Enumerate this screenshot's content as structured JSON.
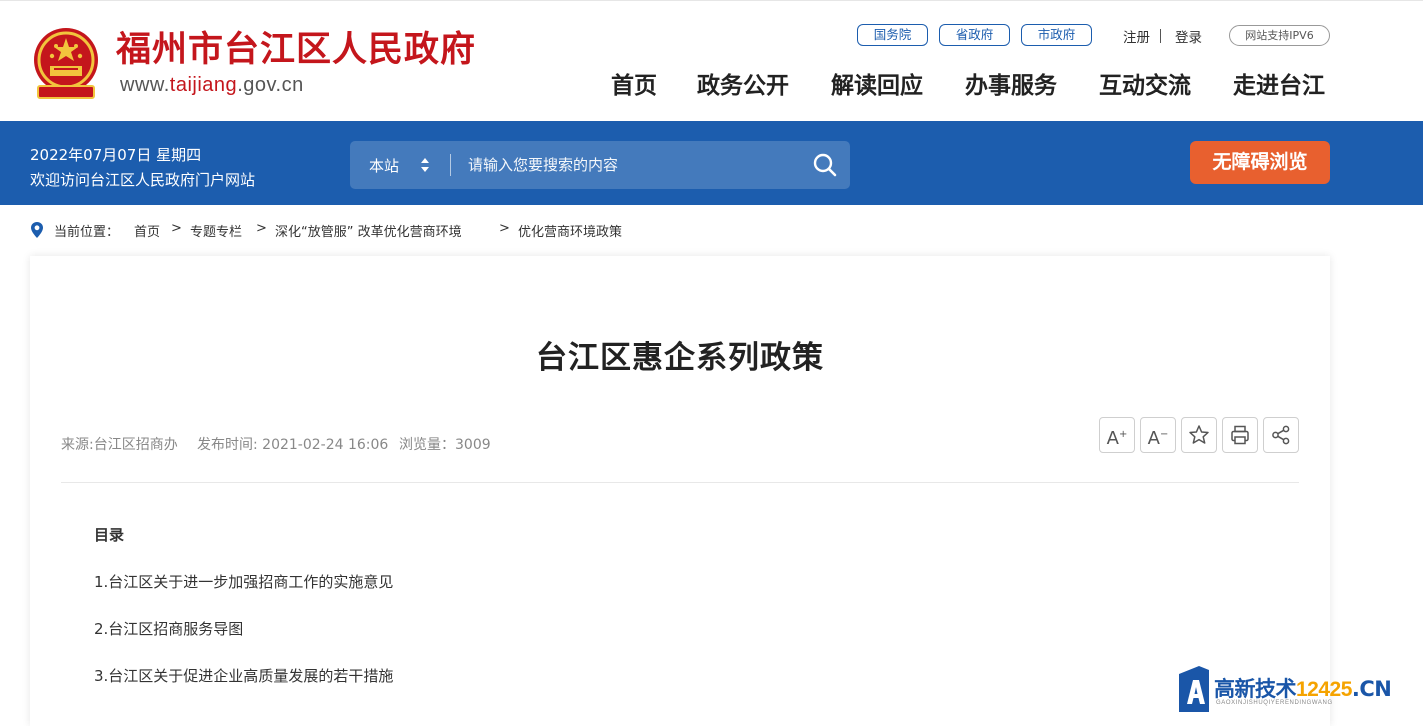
{
  "header": {
    "site_name": "福州市台江区人民政府",
    "domain_prefix": "www.",
    "domain_highlight": "taijiang",
    "domain_suffix": ".gov.cn",
    "gov_links": [
      "国务院",
      "省政府",
      "市政府"
    ],
    "register_label": "注册",
    "login_label": "登录",
    "ipv6_label": "网站支持IPV6",
    "nav": [
      "首页",
      "政务公开",
      "解读回应",
      "办事服务",
      "互动交流",
      "走进台江"
    ]
  },
  "band": {
    "date_text": "2022年07月07日 星期四",
    "welcome_text": "欢迎访问台江区人民政府门户网站",
    "search_scope": "本站",
    "search_placeholder": "请输入您要搜索的内容",
    "accessibility_label": "无障碍浏览"
  },
  "breadcrumb": {
    "label": "当前位置：",
    "items": [
      "首页",
      "专题专栏",
      "深化“放管服” 改革优化营商环境",
      "优化营商环境政策"
    ],
    "separator": ">"
  },
  "article": {
    "title": "台江区惠企系列政策",
    "source": "来源:台江区招商办",
    "publish_time": "发布时间: 2021-02-24 16:06",
    "views": "浏览量：3009",
    "toc_title": "目录",
    "toc": [
      "1.台江区关于进一步加强招商工作的实施意见",
      "2.台江区招商服务导图",
      "3.台江区关于促进企业高质量发展的若干措施"
    ]
  },
  "watermark": {
    "text_cn": "高新技术",
    "text_num": "12425",
    "text_tld": ".CN",
    "subtitle": "GAOXINJISHUQIYERENDINGWANG"
  },
  "colors": {
    "brand_red": "#c4161c",
    "band_blue": "#1c5dae",
    "accessibility_orange": "#e8602f"
  }
}
